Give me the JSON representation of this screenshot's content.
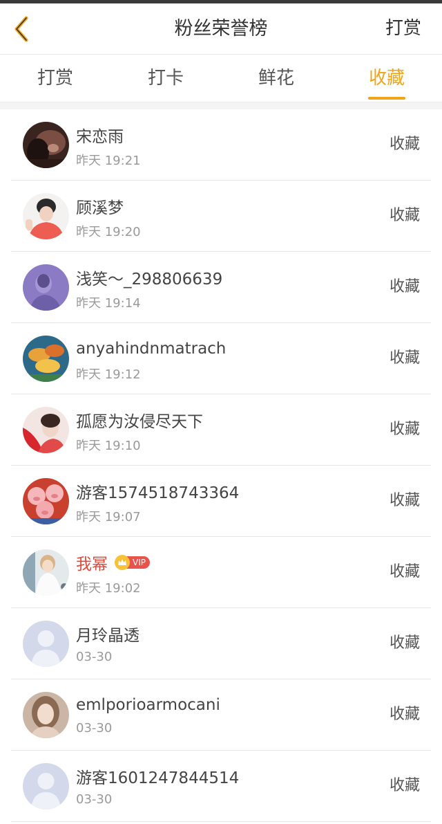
{
  "header": {
    "title": "粉丝荣誉榜",
    "right_action": "打赏"
  },
  "tabs": [
    {
      "label": "打赏",
      "active": false
    },
    {
      "label": "打卡",
      "active": false
    },
    {
      "label": "鲜花",
      "active": false
    },
    {
      "label": "收藏",
      "active": true
    }
  ],
  "colors": {
    "accent": "#f0a417",
    "vip_name": "#e2483a",
    "vip_badge": "#e8534c"
  },
  "list": [
    {
      "name": "宋恋雨",
      "time": "昨天 19:21",
      "action": "收藏",
      "avatar": "photo-dark",
      "vip": false
    },
    {
      "name": "顾溪梦",
      "time": "昨天 19:20",
      "action": "收藏",
      "avatar": "photo-person",
      "vip": false
    },
    {
      "name": "浅笑～_298806639",
      "time": "昨天 19:14",
      "action": "收藏",
      "avatar": "photo-purple",
      "vip": false
    },
    {
      "name": "anyahindnmatrach",
      "time": "昨天 19:12",
      "action": "收藏",
      "avatar": "photo-fish",
      "vip": false
    },
    {
      "name": "孤愿为汝侵尽天下",
      "time": "昨天 19:10",
      "action": "收藏",
      "avatar": "photo-red",
      "vip": false
    },
    {
      "name": "游客1574518743364",
      "time": "昨天 19:07",
      "action": "收藏",
      "avatar": "photo-pigs",
      "vip": false
    },
    {
      "name": "我幂",
      "time": "昨天 19:02",
      "action": "收藏",
      "avatar": "photo-white",
      "vip": true,
      "vip_label": "VIP"
    },
    {
      "name": "月玲晶透",
      "time": "03-30",
      "action": "收藏",
      "avatar": "default-avatar",
      "vip": false
    },
    {
      "name": "emlporioarmocani",
      "time": "03-30",
      "action": "收藏",
      "avatar": "photo-girl",
      "vip": false
    },
    {
      "name": "游客1601247844514",
      "time": "03-30",
      "action": "收藏",
      "avatar": "default-avatar",
      "vip": false
    }
  ]
}
